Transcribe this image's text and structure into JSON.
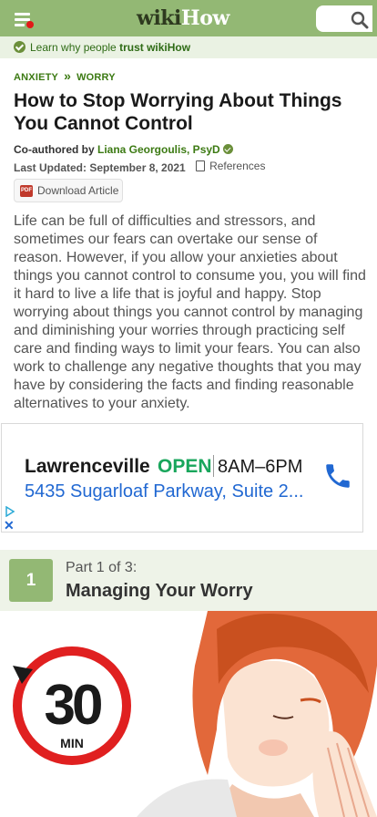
{
  "header": {
    "logo_wiki": "wiki",
    "logo_how": "How",
    "search_placeholder": ""
  },
  "trust_bar": {
    "text": "Learn why people ",
    "bold": "trust wikiHow"
  },
  "breadcrumb": [
    "ANXIETY",
    "»",
    "WORRY"
  ],
  "article": {
    "title": "How to Stop Worrying About Things You Cannot Control",
    "coauthored_label": "Co-authored by ",
    "author": "Liana Georgoulis, PsyD",
    "updated_label": "Last Updated: September 8, 2021",
    "references_label": "References",
    "download_label": "Download Article",
    "intro": "Life can be full of difficulties and stressors, and sometimes our fears can overtake our sense of reason. However, if you allow your anxieties about things you cannot control to consume you, you will find it hard to live a life that is joyful and happy. Stop worrying about things you cannot control by managing and diminishing your worries through practicing self care and finding ways to limit your fears. You can also work to challenge any negative thoughts that you may have by considering the facts and finding reasonable alternatives to your anxiety."
  },
  "ad": {
    "name": "Lawrenceville",
    "status": "OPEN",
    "hours": "8AM–6PM",
    "address": "5435 Sugarloaf Parkway, Suite 2...",
    "close_glyph": "✕"
  },
  "part": {
    "number": "1",
    "label": "Part 1 of 3:",
    "title": "Managing Your Worry"
  },
  "illustration": {
    "timer_value": "30",
    "timer_unit": "MIN"
  },
  "colors": {
    "brand_green": "#93b874",
    "link_green": "#3c7a13",
    "ad_blue": "#2168d2",
    "open_green": "#19a65c",
    "timer_red": "#e02020"
  }
}
